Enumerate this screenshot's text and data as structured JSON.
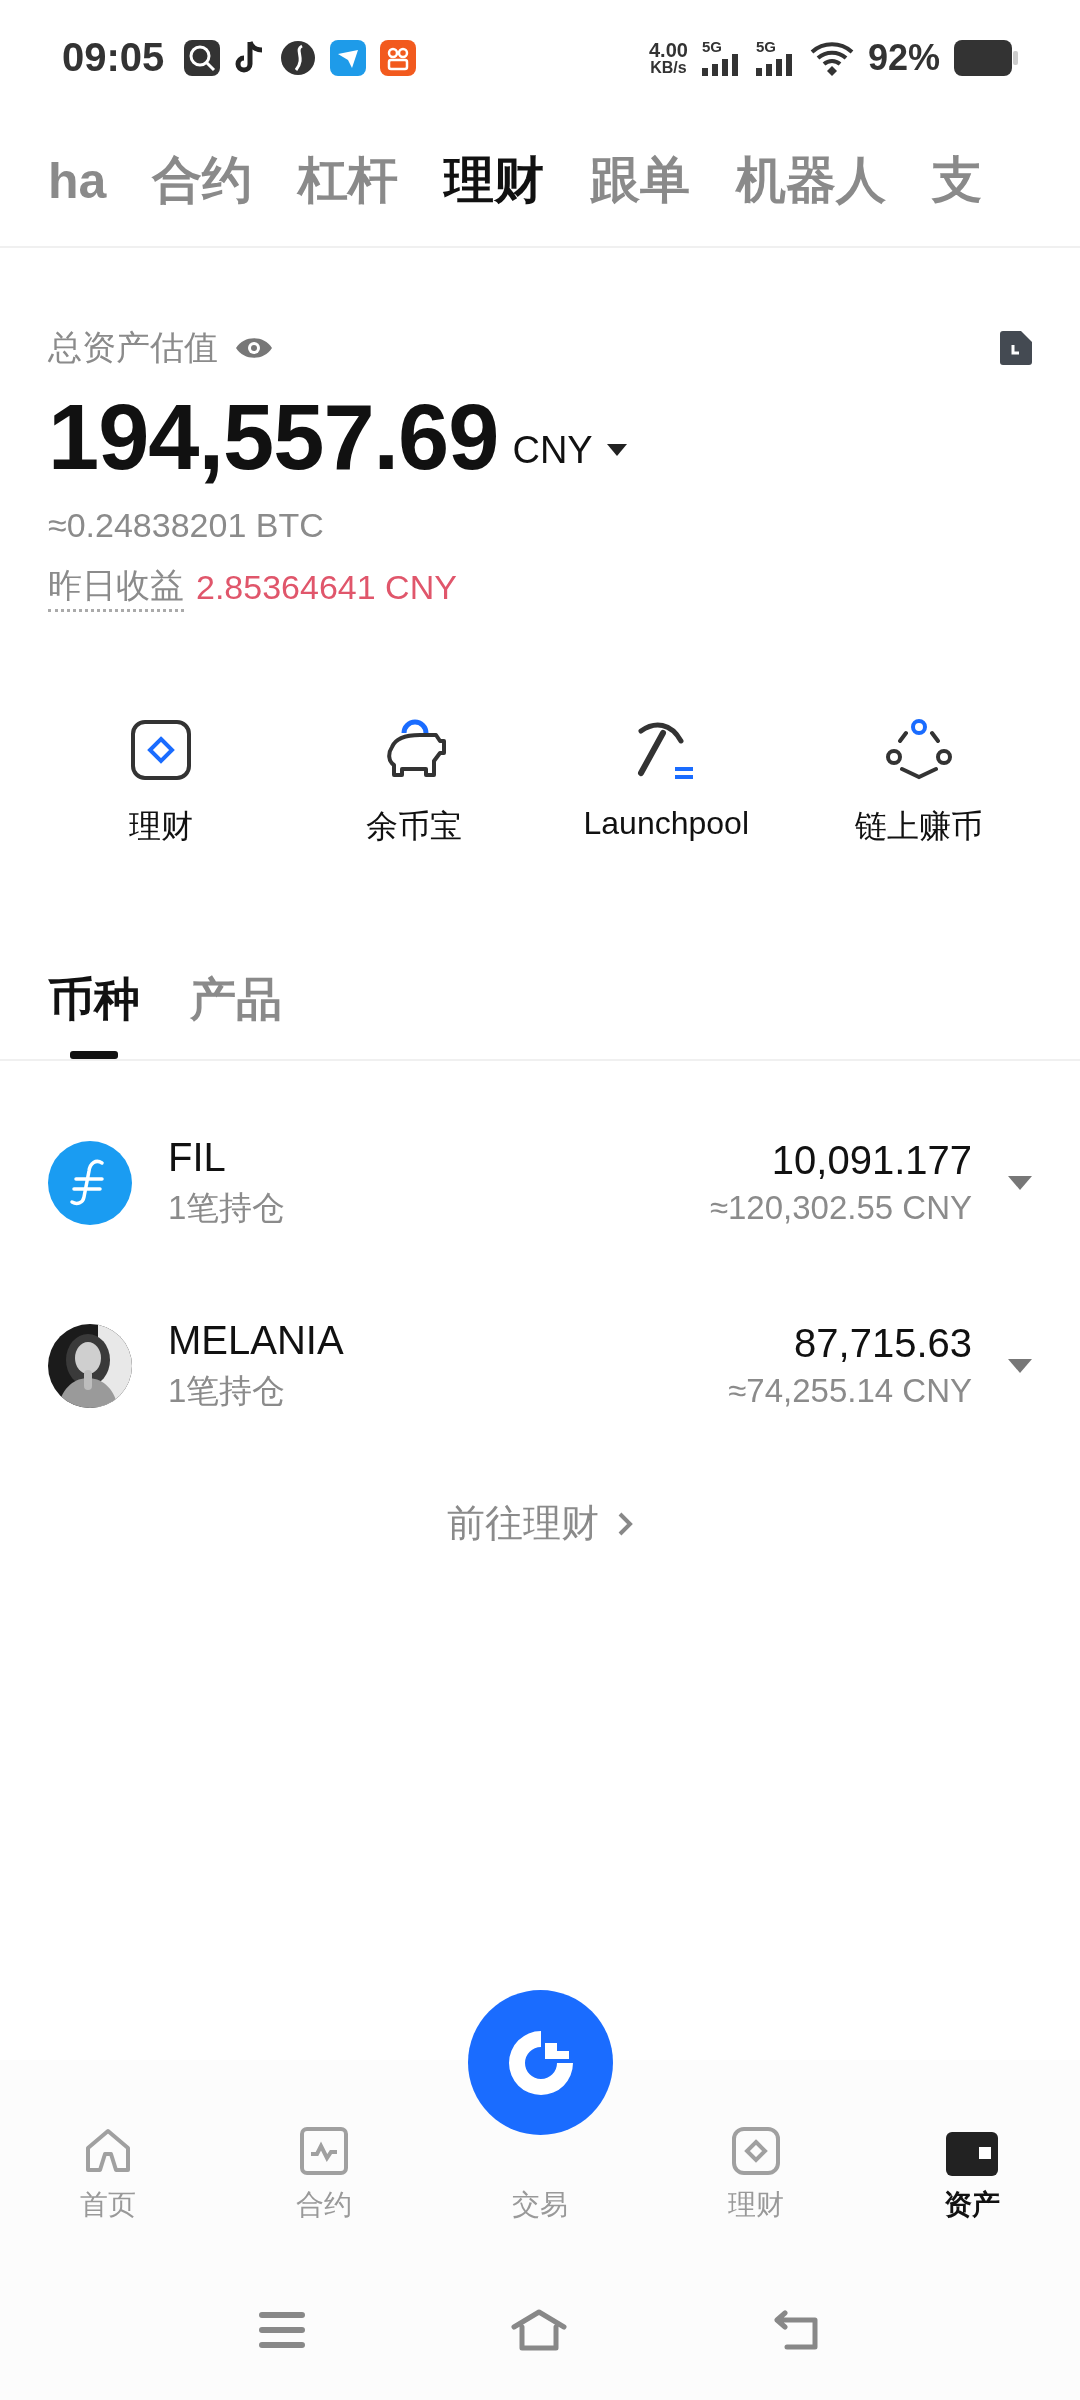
{
  "status_bar": {
    "time": "09:05",
    "speed_value": "4.00",
    "speed_unit": "KB/s",
    "signal_1": "5G",
    "signal_2": "5G",
    "battery": "92%"
  },
  "top_tabs": [
    {
      "label": "ha",
      "selected": false
    },
    {
      "label": "合约",
      "selected": false
    },
    {
      "label": "杠杆",
      "selected": false
    },
    {
      "label": "理财",
      "selected": true
    },
    {
      "label": "跟单",
      "selected": false
    },
    {
      "label": "机器人",
      "selected": false
    },
    {
      "label": "支",
      "selected": false
    }
  ],
  "summary": {
    "label": "总资产估值",
    "total": "194,557.69",
    "currency": "CNY",
    "btc": "≈0.24838201 BTC",
    "yesterday_label": "昨日收益",
    "yesterday_value": "2.85364641 CNY"
  },
  "shortcuts": [
    {
      "kind": "finance",
      "label": "理财"
    },
    {
      "kind": "savings",
      "label": "余币宝"
    },
    {
      "kind": "pool",
      "label": "Launchpool"
    },
    {
      "kind": "onchain",
      "label": "链上赚币"
    }
  ],
  "sub_tabs": [
    {
      "label": "币种",
      "selected": true
    },
    {
      "label": "产品",
      "selected": false
    }
  ],
  "holdings": [
    {
      "kind": "coin",
      "name": "FIL",
      "positions": "1笔持仓",
      "amount": "10,091.177",
      "value": "≈120,302.55 CNY"
    },
    {
      "kind": "picture",
      "name": "MELANIA",
      "positions": "1笔持仓",
      "amount": "87,715.63",
      "value": "≈74,255.14 CNY"
    }
  ],
  "more_link": "前往理财",
  "bottom_nav": [
    {
      "kind": "home",
      "label": "首页",
      "selected": false
    },
    {
      "kind": "contract",
      "label": "合约",
      "selected": false
    },
    {
      "kind": "trade",
      "label": "交易",
      "selected": false
    },
    {
      "kind": "finance",
      "label": "理财",
      "selected": false
    },
    {
      "kind": "wallet",
      "label": "资产",
      "selected": true
    }
  ]
}
